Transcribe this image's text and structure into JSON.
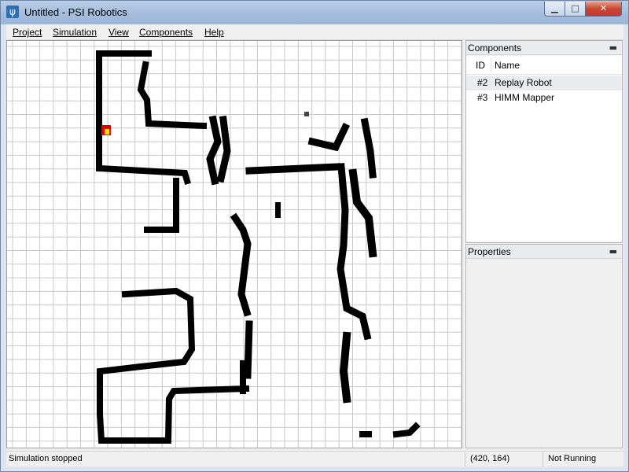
{
  "window": {
    "title": "Untitled - PSI Robotics",
    "app_icon_glyph": "ψ",
    "controls": {
      "minimize": "▁",
      "maximize": "□",
      "close": "✕"
    }
  },
  "menu": {
    "project": "Project",
    "simulation": "Simulation",
    "view": "View",
    "components": "Components",
    "help": "Help"
  },
  "components_panel": {
    "title": "Components",
    "columns": {
      "id": "ID",
      "name": "Name"
    },
    "rows": [
      {
        "id": "#2",
        "name": "Replay Robot",
        "selected": true
      },
      {
        "id": "#3",
        "name": "HIMM Mapper",
        "selected": false
      }
    ]
  },
  "properties_panel": {
    "title": "Properties"
  },
  "status": {
    "message": "Simulation stopped",
    "coordinates": "(420, 164)",
    "state": "Not Running"
  },
  "colors": {
    "robot_outer": "#e00000",
    "robot_inner": "#ffd800",
    "obstacle": "#000000",
    "grid": "#c8c8c8"
  },
  "icons": {
    "panel_pin": "pin-icon",
    "app": "psi-app-icon"
  }
}
